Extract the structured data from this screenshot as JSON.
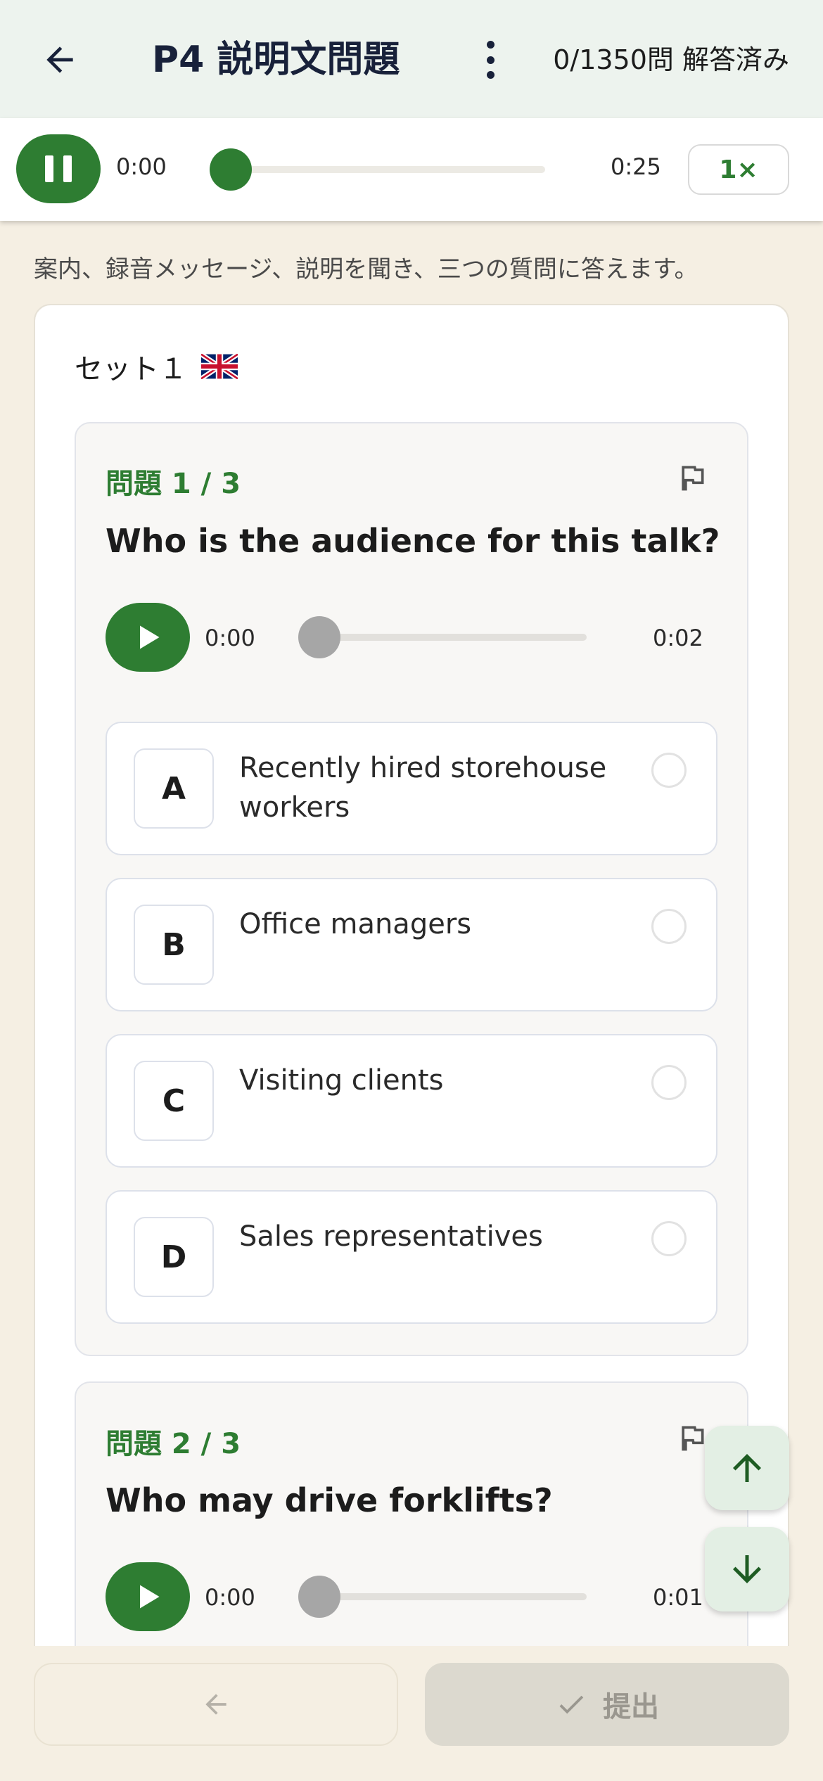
{
  "header": {
    "title": "P4 説明文問題",
    "progress": "0/1350問 解答済み",
    "back_icon": "arrow-left-icon",
    "menu_icon": "more-vert-icon"
  },
  "player": {
    "current_time": "0:00",
    "total_time": "0:25",
    "speed": "1×",
    "progress_fraction": 0
  },
  "instructions": "案内、録音メッセージ、説明を聞き、三つの質問に答えます。",
  "set": {
    "title": "セット１",
    "flag_icon": "uk-flag-icon"
  },
  "questions": [
    {
      "number": "問題 1 / 3",
      "text": "Who is the audience for this talk?",
      "audio_current": "0:00",
      "audio_total": "0:02",
      "options": [
        {
          "letter": "A",
          "text": "Recently hired storehouse workers"
        },
        {
          "letter": "B",
          "text": "Office managers"
        },
        {
          "letter": "C",
          "text": "Visiting clients"
        },
        {
          "letter": "D",
          "text": "Sales representatives"
        }
      ]
    },
    {
      "number": "問題 2 / 3",
      "text": "Who may drive forklifts?",
      "audio_current": "0:00",
      "audio_total": "0:01"
    }
  ],
  "footer": {
    "prev_icon": "arrow-left-icon",
    "submit_label": "提出",
    "submit_icon": "check-icon"
  },
  "colors": {
    "accent": "#2e7d32",
    "header_bg": "#edf3ee",
    "page_bg": "#f5efe3"
  }
}
